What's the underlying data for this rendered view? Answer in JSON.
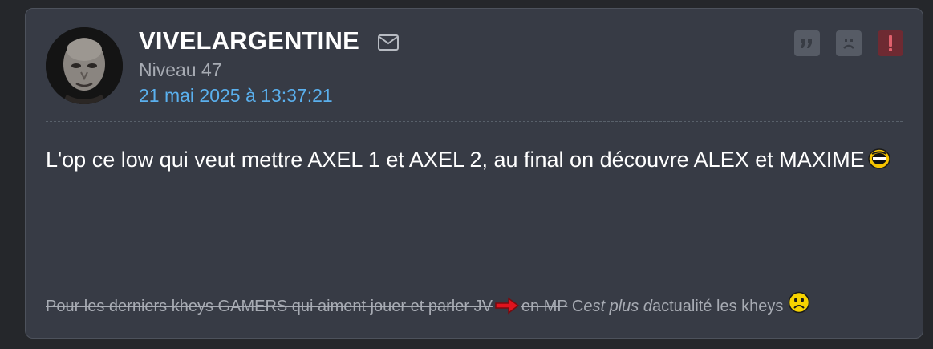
{
  "post": {
    "author": "VIVELARGENTINE",
    "level": "Niveau 47",
    "date": "21 mai 2025 à 13:37:21",
    "message": {
      "text": "L'op ce low qui veut mettre AXEL 1 et AXEL 2, au final on découvre ALEX et MAXIME"
    },
    "icons": {
      "mail": "mail-icon",
      "quote": "quote-icon",
      "sad": "sad-face-icon",
      "report": "report-icon",
      "laughing_smiley": "laughing-smiley-icon",
      "arrow": "red-arrow-icon",
      "worried_smiley": "worried-smiley-icon"
    },
    "colors": {
      "date_link": "#5ab0ee",
      "report_button": "#6e2a32",
      "card_background": "#373b45"
    }
  },
  "signature": {
    "struck_text": "Pour les derniers kheys GAMERS qui aiment jouer et parler JV",
    "struck_text_2": "en MP",
    "part1": "C",
    "part2_italic": "est plus d",
    "part3": "actualité les kheys"
  }
}
